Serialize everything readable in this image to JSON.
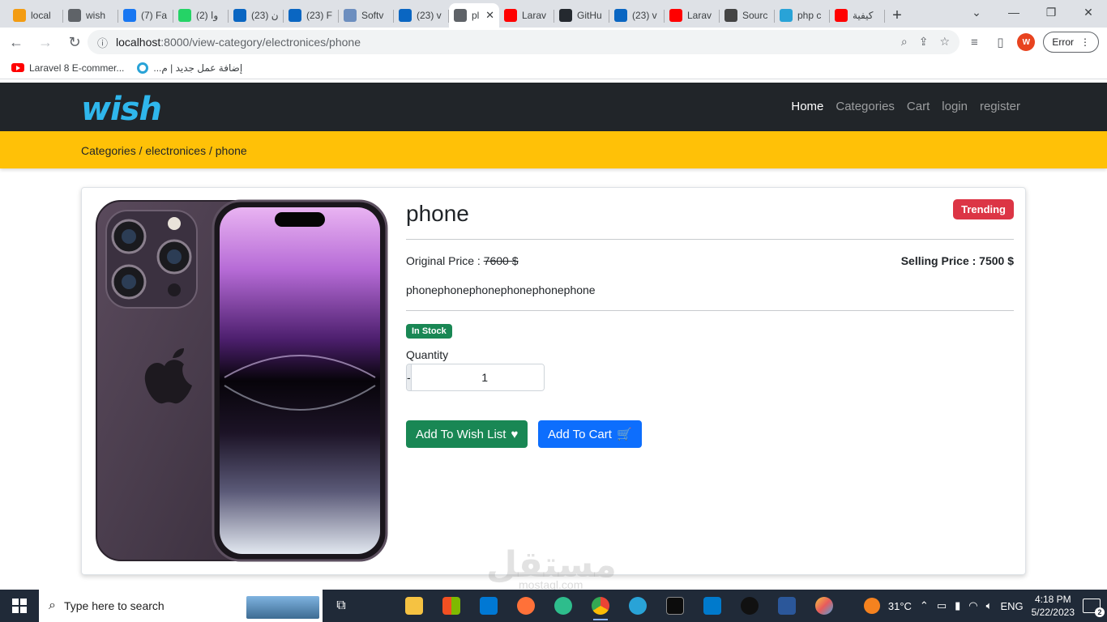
{
  "browser": {
    "tabs": [
      {
        "label": "local",
        "fav_color": "#f39c12",
        "icon": "pma-icon"
      },
      {
        "label": "wish",
        "fav_color": "#5f6368",
        "icon": "globe-icon"
      },
      {
        "label": "(7) Fa",
        "fav_color": "#1877f2",
        "icon": "facebook-icon"
      },
      {
        "label": "(2) وا",
        "fav_color": "#25d366",
        "icon": "whatsapp-icon"
      },
      {
        "label": "(23) ن",
        "fav_color": "#0a66c2",
        "icon": "linkedin-icon"
      },
      {
        "label": "(23) F",
        "fav_color": "#0a66c2",
        "icon": "linkedin-icon"
      },
      {
        "label": "Softv",
        "fav_color": "#6c8ebf",
        "icon": "software-icon"
      },
      {
        "label": "(23) v",
        "fav_color": "#0a66c2",
        "icon": "linkedin-icon"
      },
      {
        "label": "pl",
        "fav_color": "#5f6368",
        "icon": "globe-icon",
        "active": true
      },
      {
        "label": "Larav",
        "fav_color": "#ff0000",
        "icon": "youtube-icon"
      },
      {
        "label": "GitHu",
        "fav_color": "#24292f",
        "icon": "github-icon"
      },
      {
        "label": "(23) v",
        "fav_color": "#0a66c2",
        "icon": "linkedin-icon"
      },
      {
        "label": "Larav",
        "fav_color": "#ff0000",
        "icon": "youtube-icon"
      },
      {
        "label": "Sourc",
        "fav_color": "#444444",
        "icon": "source-icon"
      },
      {
        "label": "php c",
        "fav_color": "#29a3d7",
        "icon": "ring-icon"
      },
      {
        "label": "كيفية",
        "fav_color": "#ff0000",
        "icon": "youtube-icon"
      }
    ],
    "url_host": "localhost",
    "url_path": ":8000/view-category/electronices/phone",
    "error_label": "Error",
    "avatar_letter": "W",
    "bookmarks": [
      {
        "label": "Laravel 8 E-commer...",
        "icon": "youtube-icon"
      },
      {
        "label": "إضافة عمل جديد | م...",
        "icon": "ring-icon"
      }
    ]
  },
  "site": {
    "brand": "wish",
    "nav": [
      {
        "label": "Home",
        "active": true
      },
      {
        "label": "Categories",
        "active": false
      },
      {
        "label": "Cart",
        "active": false
      },
      {
        "label": "login",
        "active": false
      },
      {
        "label": "register",
        "active": false
      }
    ],
    "breadcrumb": "Categories / electronices / phone"
  },
  "product": {
    "name": "phone",
    "badge": "Trending",
    "original_price_label": "Original Price : ",
    "original_price": "7600 $",
    "selling_price": "Selling Price : 7500 $",
    "description": "phonephonephonephonephonephone",
    "stock_badge": "In Stock",
    "quantity_label": "Quantity",
    "quantity_value": "1",
    "decrement": "-",
    "increment": "+",
    "wishlist_button": "Add To Wish List",
    "cart_button": "Add To Cart"
  },
  "watermark": {
    "text": "مستقل",
    "sub": "mostaql.com"
  },
  "taskbar": {
    "search_placeholder": "Type here to search",
    "weather": "31°C",
    "language": "ENG",
    "time": "4:18 PM",
    "date": "5/22/2023",
    "notifications": "2"
  },
  "colors": {
    "navbar": "#212529",
    "breadcrumb_bar": "#ffc107",
    "trending": "#dc3545",
    "in_stock": "#198754",
    "wish_button": "#198754",
    "cart_button": "#0d6efd",
    "brand": "#2fb7ec"
  }
}
